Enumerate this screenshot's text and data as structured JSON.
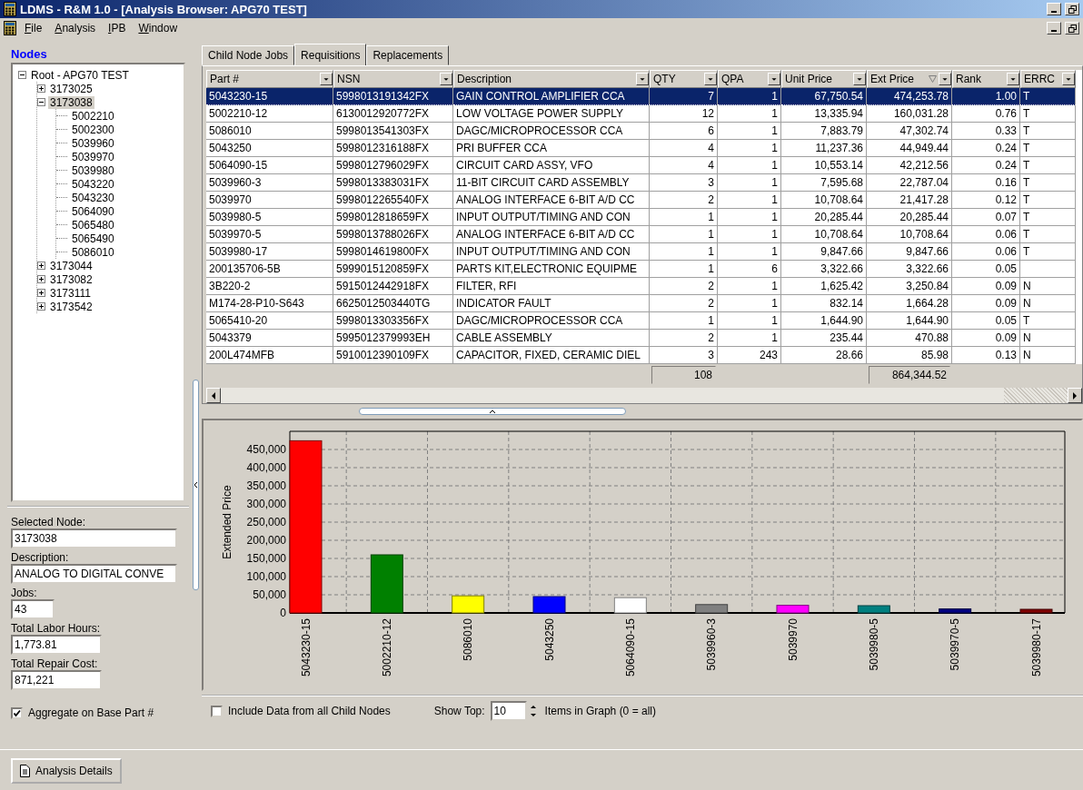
{
  "window": {
    "title": "LDMS - R&M 1.0 - [Analysis Browser: APG70 TEST]"
  },
  "menu": [
    "File",
    "Analysis",
    "IPB",
    "Window"
  ],
  "nodes": {
    "title": "Nodes",
    "tree": [
      {
        "label": "Root - APG70 TEST",
        "expanded": true,
        "selected": false,
        "children": [
          {
            "label": "3173025",
            "expanded": false,
            "selected": false
          },
          {
            "label": "3173038",
            "expanded": true,
            "selected": true,
            "children": [
              {
                "label": "5002210",
                "selected": false
              },
              {
                "label": "5002300",
                "selected": false
              },
              {
                "label": "5039960",
                "selected": false
              },
              {
                "label": "5039970",
                "selected": false
              },
              {
                "label": "5039980",
                "selected": false
              },
              {
                "label": "5043220",
                "selected": false
              },
              {
                "label": "5043230",
                "selected": false
              },
              {
                "label": "5064090",
                "selected": false
              },
              {
                "label": "5065480",
                "selected": false
              },
              {
                "label": "5065490",
                "selected": false
              },
              {
                "label": "5086010",
                "selected": false
              }
            ]
          },
          {
            "label": "3173044",
            "expanded": false,
            "selected": false
          },
          {
            "label": "3173082",
            "expanded": false,
            "selected": false
          },
          {
            "label": "3173111",
            "expanded": false,
            "selected": false
          },
          {
            "label": "3173542",
            "expanded": false,
            "selected": false
          }
        ]
      }
    ]
  },
  "details": [
    {
      "label": "Selected Node:",
      "value": "3173038"
    },
    {
      "label": "Description:",
      "value": "ANALOG TO DIGITAL CONVE"
    },
    {
      "label": "Jobs:",
      "value": "43"
    },
    {
      "label": "Total Labor Hours:",
      "value": "1,773.81"
    },
    {
      "label": "Total Repair Cost:",
      "value": "871,221"
    }
  ],
  "aggregate": {
    "label": "Aggregate on Base Part #",
    "checked": true
  },
  "tabs": [
    {
      "label": "Child Node Jobs",
      "selected": false
    },
    {
      "label": "Requisitions",
      "selected": true
    },
    {
      "label": "Replacements",
      "selected": false
    }
  ],
  "table": {
    "columns": [
      {
        "label": "Part #",
        "sorted": false
      },
      {
        "label": "NSN",
        "sorted": false
      },
      {
        "label": "Description",
        "sorted": false
      },
      {
        "label": "QTY",
        "sorted": false
      },
      {
        "label": "QPA",
        "sorted": false
      },
      {
        "label": "Unit Price",
        "sorted": false
      },
      {
        "label": "Ext Price",
        "sorted": true
      },
      {
        "label": "Rank",
        "sorted": false
      },
      {
        "label": "ERRC",
        "sorted": false
      }
    ],
    "rows": [
      {
        "selected": true,
        "cells": [
          "5043230-15",
          "5998013191342FX",
          "GAIN CONTROL AMPLIFIER CCA",
          "7",
          "1",
          "67,750.54",
          "474,253.78",
          "1.00",
          "T"
        ]
      },
      {
        "selected": false,
        "cells": [
          "5002210-12",
          "6130012920772FX",
          "LOW VOLTAGE POWER SUPPLY",
          "12",
          "1",
          "13,335.94",
          "160,031.28",
          "0.76",
          "T"
        ]
      },
      {
        "selected": false,
        "cells": [
          "5086010",
          "5998013541303FX",
          "DAGC/MICROPROCESSOR CCA",
          "6",
          "1",
          "7,883.79",
          "47,302.74",
          "0.33",
          "T"
        ]
      },
      {
        "selected": false,
        "cells": [
          "5043250",
          "5998012316188FX",
          "PRI BUFFER CCA",
          "4",
          "1",
          "11,237.36",
          "44,949.44",
          "0.24",
          "T"
        ]
      },
      {
        "selected": false,
        "cells": [
          "5064090-15",
          "5998012796029FX",
          "CIRCUIT CARD ASSY, VFO",
          "4",
          "1",
          "10,553.14",
          "42,212.56",
          "0.24",
          "T"
        ]
      },
      {
        "selected": false,
        "cells": [
          "5039960-3",
          "5998013383031FX",
          "11-BIT CIRCUIT CARD ASSEMBLY",
          "3",
          "1",
          "7,595.68",
          "22,787.04",
          "0.16",
          "T"
        ]
      },
      {
        "selected": false,
        "cells": [
          "5039970",
          "5998012265540FX",
          "ANALOG INTERFACE 6-BIT A/D CC",
          "2",
          "1",
          "10,708.64",
          "21,417.28",
          "0.12",
          "T"
        ]
      },
      {
        "selected": false,
        "cells": [
          "5039980-5",
          "5998012818659FX",
          "INPUT OUTPUT/TIMING AND CON",
          "1",
          "1",
          "20,285.44",
          "20,285.44",
          "0.07",
          "T"
        ]
      },
      {
        "selected": false,
        "cells": [
          "5039970-5",
          "5998013788026FX",
          "ANALOG INTERFACE 6-BIT A/D CC",
          "1",
          "1",
          "10,708.64",
          "10,708.64",
          "0.06",
          "T"
        ]
      },
      {
        "selected": false,
        "cells": [
          "5039980-17",
          "5998014619800FX",
          "INPUT OUTPUT/TIMING AND CON",
          "1",
          "1",
          "9,847.66",
          "9,847.66",
          "0.06",
          "T"
        ]
      },
      {
        "selected": false,
        "cells": [
          "200135706-5B",
          "5999015120859FX",
          "PARTS KIT,ELECTRONIC EQUIPME",
          "1",
          "6",
          "3,322.66",
          "3,322.66",
          "0.05",
          null
        ]
      },
      {
        "selected": false,
        "cells": [
          "3B220-2",
          "5915012442918FX",
          "FILTER, RFI",
          "2",
          "1",
          "1,625.42",
          "3,250.84",
          "0.09",
          "N"
        ]
      },
      {
        "selected": false,
        "cells": [
          "M174-28-P10-S643",
          "6625012503440TG",
          "INDICATOR FAULT",
          "2",
          "1",
          "832.14",
          "1,664.28",
          "0.09",
          "N"
        ]
      },
      {
        "selected": false,
        "cells": [
          "5065410-20",
          "5998013303356FX",
          "DAGC/MICROPROCESSOR CCA",
          "1",
          "1",
          "1,644.90",
          "1,644.90",
          "0.05",
          "T"
        ]
      },
      {
        "selected": false,
        "cells": [
          "5043379",
          "5995012379993EH",
          "CABLE ASSEMBLY",
          "2",
          "1",
          "235.44",
          "470.88",
          "0.09",
          "N"
        ]
      },
      {
        "selected": false,
        "cells": [
          "200L474MFB",
          "5910012390109FX",
          "CAPACITOR, FIXED, CERAMIC DIEL",
          "3",
          "243",
          "28.66",
          "85.98",
          "0.13",
          "N"
        ]
      }
    ],
    "totals": {
      "qty": "108",
      "ext_price": "864,344.52"
    }
  },
  "chart": {
    "chart_data": {
      "type": "bar",
      "ylabel": "Extended Price",
      "categories": [
        "5043230-15",
        "5002210-12",
        "5086010",
        "5043250",
        "5064090-15",
        "5039960-3",
        "5039970",
        "5039980-5",
        "5039970-5",
        "5039980-17"
      ],
      "colors": [
        "#ff0000",
        "#008000",
        "#ffff00",
        "#0000ff",
        "#ffffff",
        "#808080",
        "#ff00ff",
        "#008080",
        "#000080",
        "#800000"
      ],
      "values": [
        474000,
        160000,
        47000,
        45000,
        42000,
        23000,
        21000,
        20000,
        11000,
        10000
      ],
      "grid": true,
      "ylim": [
        0,
        500000
      ],
      "yticks": [
        {
          "value": 0,
          "label": "0"
        },
        {
          "value": 50000,
          "label": "50,000"
        },
        {
          "value": 100000,
          "label": "100,000"
        },
        {
          "value": 150000,
          "label": "150,000"
        },
        {
          "value": 200000,
          "label": "200,000"
        },
        {
          "value": 250000,
          "label": "250,000"
        },
        {
          "value": 300000,
          "label": "300,000"
        },
        {
          "value": 350000,
          "label": "350,000"
        },
        {
          "value": 400000,
          "label": "400,000"
        },
        {
          "value": 450000,
          "label": "450,000"
        }
      ]
    }
  },
  "options": {
    "include": {
      "label": "Include Data from all Child Nodes",
      "checked": false
    },
    "show_top_label": "Show Top:",
    "show_top_value": "10",
    "show_top_suffix": "Items in Graph (0 = all)"
  },
  "footer": {
    "button": "Analysis Details"
  }
}
